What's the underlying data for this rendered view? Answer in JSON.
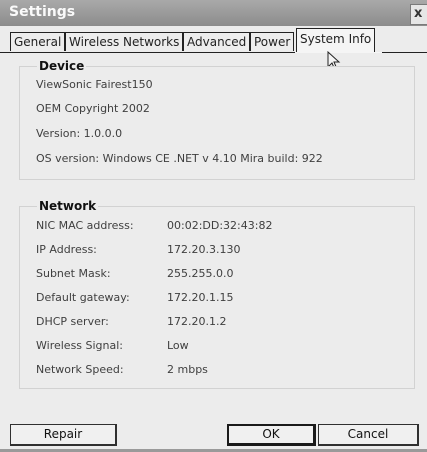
{
  "window": {
    "title": "Settings",
    "close_glyph": "x"
  },
  "tabs": [
    {
      "label": "General",
      "active": false
    },
    {
      "label": "Wireless Networks",
      "active": false
    },
    {
      "label": "Advanced",
      "active": false
    },
    {
      "label": "Power",
      "active": false
    },
    {
      "label": "System Info",
      "active": true
    }
  ],
  "device": {
    "legend": "Device",
    "name": "ViewSonic  Fairest150",
    "copyright": "OEM Copyright 2002",
    "version": "Version:   1.0.0.0",
    "os_version": "OS version:   Windows CE .NET v 4.10 Mira build: 922"
  },
  "network": {
    "legend": "Network",
    "rows": [
      {
        "label": "NIC MAC address:",
        "value": "00:02:DD:32:43:82"
      },
      {
        "label": "IP Address:",
        "value": "172.20.3.130"
      },
      {
        "label": "Subnet Mask:",
        "value": "255.255.0.0"
      },
      {
        "label": "Default gateway:",
        "value": "172.20.1.15"
      },
      {
        "label": "DHCP server:",
        "value": "172.20.1.2"
      },
      {
        "label": "Wireless Signal:",
        "value": "Low"
      },
      {
        "label": "Network Speed:",
        "value": "2 mbps"
      }
    ]
  },
  "buttons": {
    "repair": "Repair",
    "ok": "OK",
    "cancel": "Cancel"
  },
  "icons": {
    "close": "close-icon",
    "cursor": "mouse-pointer-icon"
  }
}
